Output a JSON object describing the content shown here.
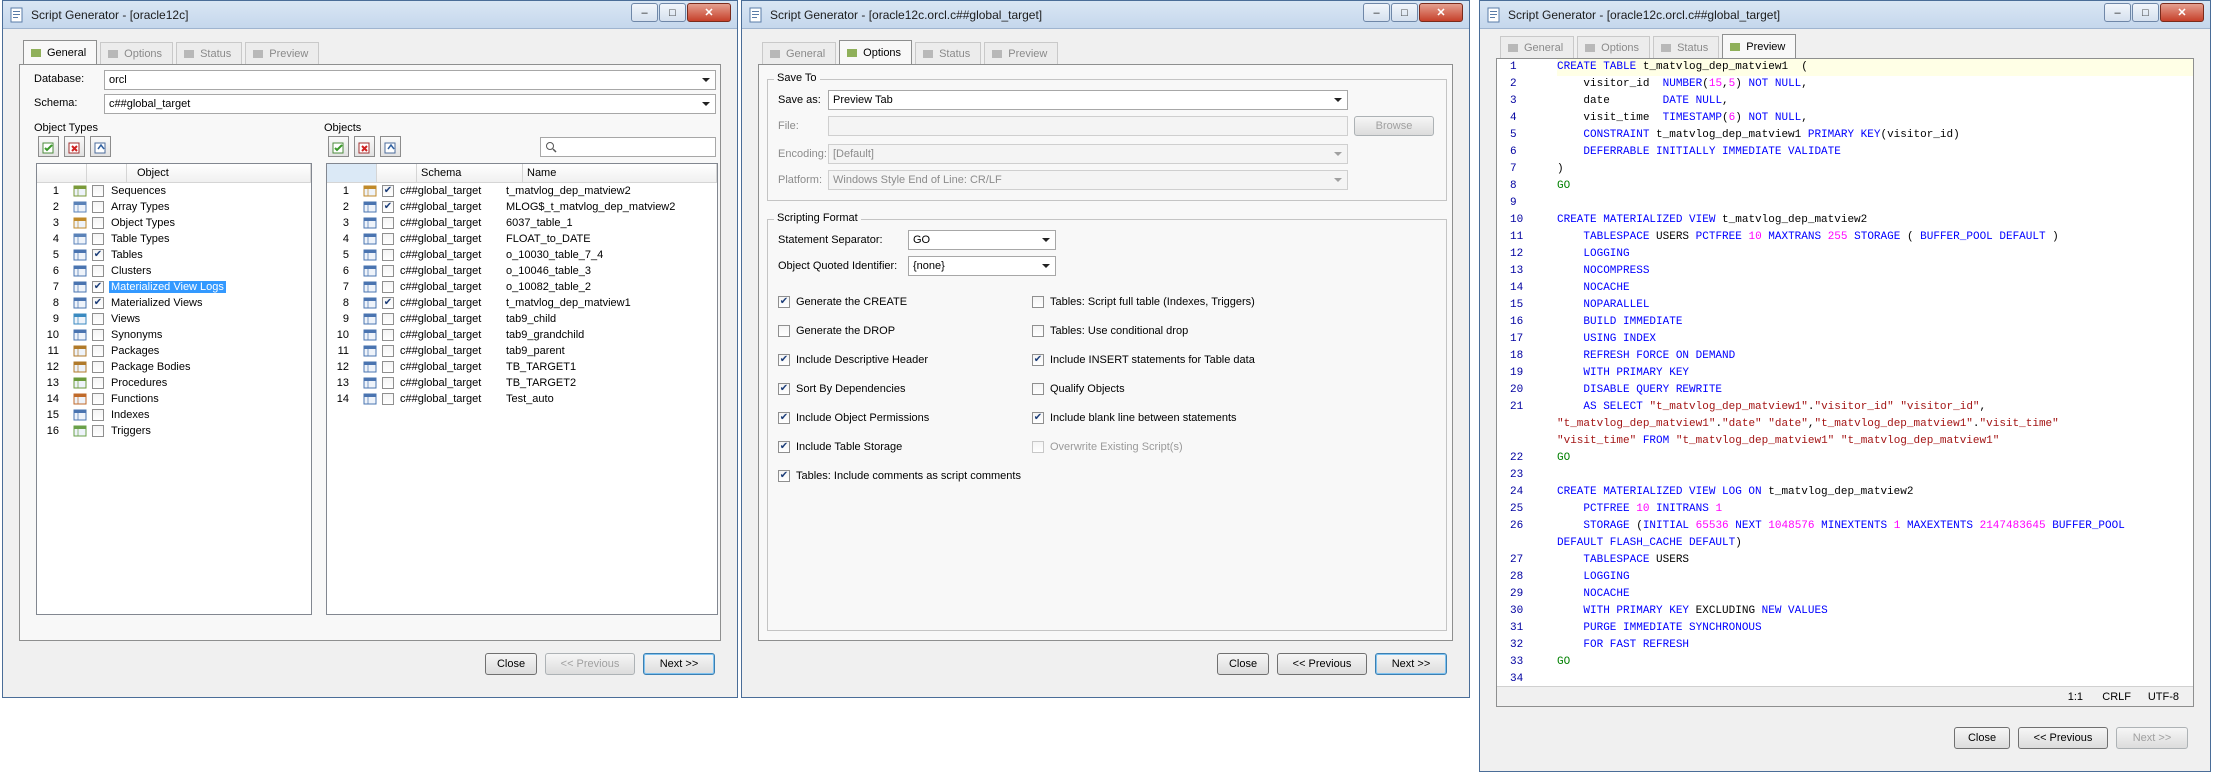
{
  "window1": {
    "title": "Script Generator - [oracle12c]",
    "tabs": [
      "General",
      "Options",
      "Status",
      "Preview"
    ],
    "database_label": "Database:",
    "database_value": "orcl",
    "schema_label": "Schema:",
    "schema_value": "c##global_target",
    "object_types_label": "Object Types",
    "objects_label": "Objects",
    "object_types_header": "Object",
    "object_types": [
      {
        "n": "1",
        "name": "Sequences",
        "checked": false,
        "icon": "sequence-icon",
        "color": "#7a9a3a"
      },
      {
        "n": "2",
        "name": "Array Types",
        "checked": false,
        "icon": "array-type-icon",
        "color": "#5a82b8"
      },
      {
        "n": "3",
        "name": "Object Types",
        "checked": false,
        "icon": "object-type-icon",
        "color": "#c08a2a"
      },
      {
        "n": "4",
        "name": "Table Types",
        "checked": false,
        "icon": "table-type-icon",
        "color": "#5a82b8"
      },
      {
        "n": "5",
        "name": "Tables",
        "checked": true,
        "icon": "table-icon",
        "color": "#4a74b0"
      },
      {
        "n": "6",
        "name": "Clusters",
        "checked": false,
        "icon": "cluster-icon",
        "color": "#4a74b0"
      },
      {
        "n": "7",
        "name": "Materialized View Logs",
        "checked": true,
        "icon": "mview-log-icon",
        "color": "#4a74b0",
        "selected": true
      },
      {
        "n": "8",
        "name": "Materialized Views",
        "checked": true,
        "icon": "mview-icon",
        "color": "#4a74b0"
      },
      {
        "n": "9",
        "name": "Views",
        "checked": false,
        "icon": "view-icon",
        "color": "#3a8ac0"
      },
      {
        "n": "10",
        "name": "Synonyms",
        "checked": false,
        "icon": "synonym-icon",
        "color": "#4a74b0"
      },
      {
        "n": "11",
        "name": "Packages",
        "checked": false,
        "icon": "package-icon",
        "color": "#b07a2a"
      },
      {
        "n": "12",
        "name": "Package Bodies",
        "checked": false,
        "icon": "package-body-icon",
        "color": "#b07a2a"
      },
      {
        "n": "13",
        "name": "Procedures",
        "checked": false,
        "icon": "procedure-icon",
        "color": "#6a9a3a"
      },
      {
        "n": "14",
        "name": "Functions",
        "checked": false,
        "icon": "function-icon",
        "color": "#c06a2a"
      },
      {
        "n": "15",
        "name": "Indexes",
        "checked": false,
        "icon": "index-icon",
        "color": "#4a74b0"
      },
      {
        "n": "16",
        "name": "Triggers",
        "checked": false,
        "icon": "trigger-icon",
        "color": "#6aa04a"
      }
    ],
    "objects_headers": [
      "Schema",
      "Name"
    ],
    "search_placeholder": "",
    "objects": [
      {
        "n": "1",
        "schema": "c##global_target",
        "name": "t_matvlog_dep_matview2",
        "checked": true,
        "icon": "mview-icon"
      },
      {
        "n": "2",
        "schema": "c##global_target",
        "name": "MLOG$_t_matvlog_dep_matview2",
        "checked": true,
        "icon": "table-icon"
      },
      {
        "n": "3",
        "schema": "c##global_target",
        "name": "6037_table_1",
        "checked": false,
        "icon": "table-icon"
      },
      {
        "n": "4",
        "schema": "c##global_target",
        "name": "FLOAT_to_DATE",
        "checked": false,
        "icon": "table-icon"
      },
      {
        "n": "5",
        "schema": "c##global_target",
        "name": "o_10030_table_7_4",
        "checked": false,
        "icon": "table-icon"
      },
      {
        "n": "6",
        "schema": "c##global_target",
        "name": "o_10046_table_3",
        "checked": false,
        "icon": "table-icon"
      },
      {
        "n": "7",
        "schema": "c##global_target",
        "name": "o_10082_table_2",
        "checked": false,
        "icon": "table-icon"
      },
      {
        "n": "8",
        "schema": "c##global_target",
        "name": "t_matvlog_dep_matview1",
        "checked": true,
        "icon": "table-icon"
      },
      {
        "n": "9",
        "schema": "c##global_target",
        "name": "tab9_child",
        "checked": false,
        "icon": "table-icon"
      },
      {
        "n": "10",
        "schema": "c##global_target",
        "name": "tab9_grandchild",
        "checked": false,
        "icon": "table-icon"
      },
      {
        "n": "11",
        "schema": "c##global_target",
        "name": "tab9_parent",
        "checked": false,
        "icon": "table-icon"
      },
      {
        "n": "12",
        "schema": "c##global_target",
        "name": "TB_TARGET1",
        "checked": false,
        "icon": "table-icon"
      },
      {
        "n": "13",
        "schema": "c##global_target",
        "name": "TB_TARGET2",
        "checked": false,
        "icon": "table-icon"
      },
      {
        "n": "14",
        "schema": "c##global_target",
        "name": "Test_auto",
        "checked": false,
        "icon": "table-icon"
      }
    ],
    "buttons": {
      "close": "Close",
      "previous": "<< Previous",
      "next": "Next >>"
    }
  },
  "window2": {
    "title": "Script Generator - [oracle12c.orcl.c##global_target]",
    "tabs": [
      "General",
      "Options",
      "Status",
      "Preview"
    ],
    "save_to_label": "Save To",
    "save_as_label": "Save as:",
    "save_as_value": "Preview Tab",
    "file_label": "File:",
    "file_value": "",
    "browse_label": "Browse",
    "encoding_label": "Encoding:",
    "encoding_value": "[Default]",
    "platform_label": "Platform:",
    "platform_value": "Windows Style End of Line: CR/LF",
    "scripting_format_label": "Scripting Format",
    "separator_label": "Statement Separator:",
    "separator_value": "GO",
    "quoted_label": "Object Quoted Identifier:",
    "quoted_value": "{none}",
    "left_options": [
      {
        "label": "Generate the CREATE",
        "checked": true
      },
      {
        "label": "Generate the DROP",
        "checked": false
      },
      {
        "label": "Include Descriptive Header",
        "checked": true
      },
      {
        "label": "Sort By Dependencies",
        "checked": true
      },
      {
        "label": "Include Object Permissions",
        "checked": true
      },
      {
        "label": "Include Table Storage",
        "checked": true
      },
      {
        "label": "Tables: Include comments as script comments",
        "checked": true
      }
    ],
    "right_options": [
      {
        "label": "Tables: Script full table (Indexes, Triggers)",
        "checked": false
      },
      {
        "label": "Tables: Use conditional drop",
        "checked": false
      },
      {
        "label": "Include INSERT statements for Table data",
        "checked": true
      },
      {
        "label": "Qualify Objects",
        "checked": false
      },
      {
        "label": "Include blank line between statements",
        "checked": true
      },
      {
        "label": "Overwrite Existing Script(s)",
        "checked": false,
        "disabled": true
      }
    ],
    "buttons": {
      "close": "Close",
      "previous": "<< Previous",
      "next": "Next >>"
    }
  },
  "window3": {
    "title": "Script Generator - [oracle12c.orcl.c##global_target]",
    "tabs": [
      "General",
      "Options",
      "Status",
      "Preview"
    ],
    "status": {
      "position": "1:1",
      "eol": "CRLF",
      "encoding": "UTF-8"
    },
    "buttons": {
      "close": "Close",
      "previous": "<< Previous",
      "next": "Next >>"
    },
    "code_lines": [
      {
        "n": "1",
        "html": "<span class='kw'>CREATE TABLE</span> t_matvlog_dep_matview1  ("
      },
      {
        "n": "2",
        "html": "    visitor_id  <span class='ty'>NUMBER</span>(<span class='nu'>15</span>,<span class='nu'>5</span>) <span class='kw'>NOT NULL</span>,"
      },
      {
        "n": "3",
        "html": "    date        <span class='ty'>DATE</span> <span class='kw'>NULL</span>,"
      },
      {
        "n": "4",
        "html": "    visit_time  <span class='ty'>TIMESTAMP</span>(<span class='nu'>6</span>) <span class='kw'>NOT NULL</span>,"
      },
      {
        "n": "5",
        "html": "    <span class='kw'>CONSTRAINT</span> t_matvlog_dep_matview1 <span class='kw'>PRIMARY KEY</span>(visitor_id)"
      },
      {
        "n": "6",
        "html": "    <span class='kw'>DEFERRABLE INITIALLY IMMEDIATE VALIDATE</span>"
      },
      {
        "n": "7",
        "html": ")"
      },
      {
        "n": "8",
        "html": "<span class='go'>GO</span>"
      },
      {
        "n": "9",
        "html": ""
      },
      {
        "n": "10",
        "html": "<span class='kw'>CREATE MATERIALIZED VIEW</span> t_matvlog_dep_matview2"
      },
      {
        "n": "11",
        "html": "    <span class='kw'>TABLESPACE</span> USERS <span class='kw'>PCTFREE</span> <span class='nu'>10</span> <span class='kw'>MAXTRANS</span> <span class='nu'>255</span> <span class='kw'>STORAGE</span> ( <span class='kw'>BUFFER_POOL DEFAULT</span> )"
      },
      {
        "n": "12",
        "html": "    <span class='kw'>LOGGING</span>"
      },
      {
        "n": "13",
        "html": "    <span class='kw'>NOCOMPRESS</span>"
      },
      {
        "n": "14",
        "html": "    <span class='kw'>NOCACHE</span>"
      },
      {
        "n": "15",
        "html": "    <span class='kw'>NOPARALLEL</span>"
      },
      {
        "n": "16",
        "html": "    <span class='kw'>BUILD IMMEDIATE</span>"
      },
      {
        "n": "17",
        "html": "    <span class='kw'>USING INDEX</span>"
      },
      {
        "n": "18",
        "html": "    <span class='kw'>REFRESH FORCE ON DEMAND</span>"
      },
      {
        "n": "19",
        "html": "    <span class='kw'>WITH PRIMARY KEY</span>"
      },
      {
        "n": "20",
        "html": "    <span class='kw'>DISABLE QUERY REWRITE</span>"
      },
      {
        "n": "21",
        "html": "    <span class='kw'>AS SELECT</span> <span class='st'>\"t_matvlog_dep_matview1\"</span>.<span class='st'>\"visitor_id\"</span> <span class='st'>\"visitor_id\"</span>,"
      },
      {
        "n": "",
        "html": "<span class='st'>\"t_matvlog_dep_matview1\"</span>.<span class='st'>\"date\"</span> <span class='st'>\"date\"</span>,<span class='st'>\"t_matvlog_dep_matview1\"</span>.<span class='st'>\"visit_time\"</span>"
      },
      {
        "n": "",
        "html": "<span class='st'>\"visit_time\"</span> <span class='kw'>FROM</span> <span class='st'>\"t_matvlog_dep_matview1\"</span> <span class='st'>\"t_matvlog_dep_matview1\"</span>"
      },
      {
        "n": "22",
        "html": "<span class='go'>GO</span>"
      },
      {
        "n": "23",
        "html": ""
      },
      {
        "n": "24",
        "html": "<span class='kw'>CREATE MATERIALIZED VIEW LOG ON</span> t_matvlog_dep_matview2"
      },
      {
        "n": "25",
        "html": "    <span class='kw'>PCTFREE</span> <span class='nu'>10</span> <span class='kw'>INITRANS</span> <span class='nu'>1</span>"
      },
      {
        "n": "26",
        "html": "    <span class='kw'>STORAGE</span> (<span class='kw'>INITIAL</span> <span class='nu'>65536</span> <span class='kw'>NEXT</span> <span class='nu'>1048576</span> <span class='kw'>MINEXTENTS</span> <span class='nu'>1</span> <span class='kw'>MAXEXTENTS</span> <span class='nu'>2147483645</span> <span class='kw'>BUFFER_POOL</span>"
      },
      {
        "n": "",
        "html": "<span class='kw'>DEFAULT FLASH_CACHE DEFAULT</span>)"
      },
      {
        "n": "27",
        "html": "    <span class='kw'>TABLESPACE</span> USERS"
      },
      {
        "n": "28",
        "html": "    <span class='kw'>LOGGING</span>"
      },
      {
        "n": "29",
        "html": "    <span class='kw'>NOCACHE</span>"
      },
      {
        "n": "30",
        "html": "    <span class='kw'>WITH PRIMARY KEY</span> EXCLUDING <span class='kw'>NEW VALUES</span>"
      },
      {
        "n": "31",
        "html": "    <span class='kw'>PURGE IMMEDIATE SYNCHRONOUS</span>"
      },
      {
        "n": "32",
        "html": "    <span class='kw'>FOR FAST REFRESH</span>"
      },
      {
        "n": "33",
        "html": "<span class='go'>GO</span>"
      },
      {
        "n": "34",
        "html": ""
      }
    ]
  }
}
